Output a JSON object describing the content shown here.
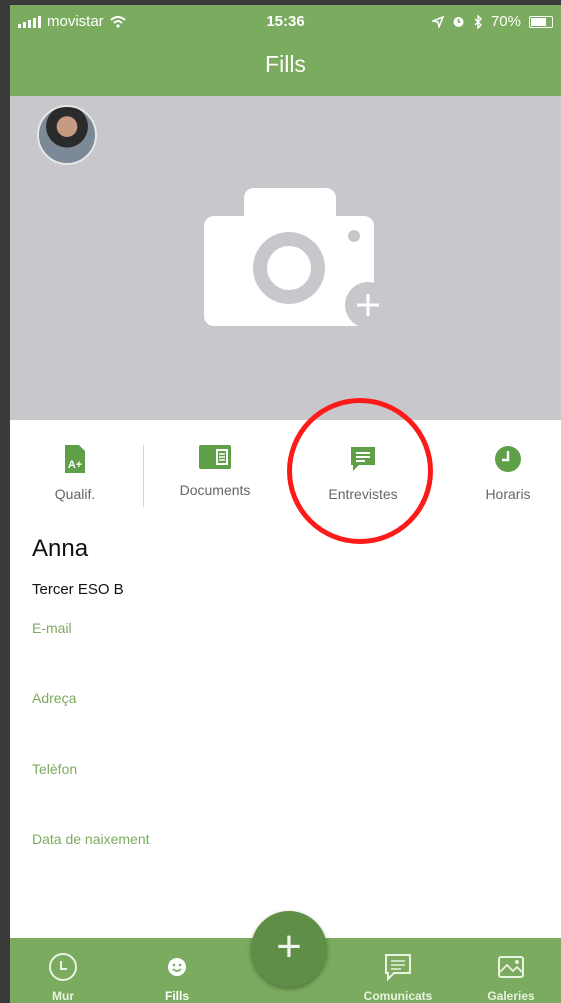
{
  "status_bar": {
    "carrier": "movistar",
    "time": "15:36",
    "battery": "70%"
  },
  "nav": {
    "title": "Fills"
  },
  "tabs": [
    {
      "label": "Qualif.",
      "icon": "grade-icon"
    },
    {
      "label": "Documents",
      "icon": "documents-icon"
    },
    {
      "label": "Entrevistes",
      "icon": "interviews-icon"
    },
    {
      "label": "Horaris",
      "icon": "clock-icon"
    }
  ],
  "profile": {
    "name": "Anna",
    "course": "Tercer ESO B",
    "fields": {
      "email": "E-mail",
      "address": "Adreça",
      "phone": "Telèfon",
      "birthdate": "Data de naixement"
    }
  },
  "bottom_nav": [
    {
      "label": "Mur",
      "icon": "clock-circle-icon"
    },
    {
      "label": "Fills",
      "icon": "smiley-icon"
    },
    {
      "label": "Comunicats",
      "icon": "message-icon"
    },
    {
      "label": "Galeries",
      "icon": "gallery-icon"
    }
  ],
  "fab": {
    "label": "+"
  },
  "colors": {
    "accent": "#7aab5e",
    "fab": "#5f8f46",
    "cover": "#c8c8cc",
    "highlight": "#ff1a1a"
  }
}
